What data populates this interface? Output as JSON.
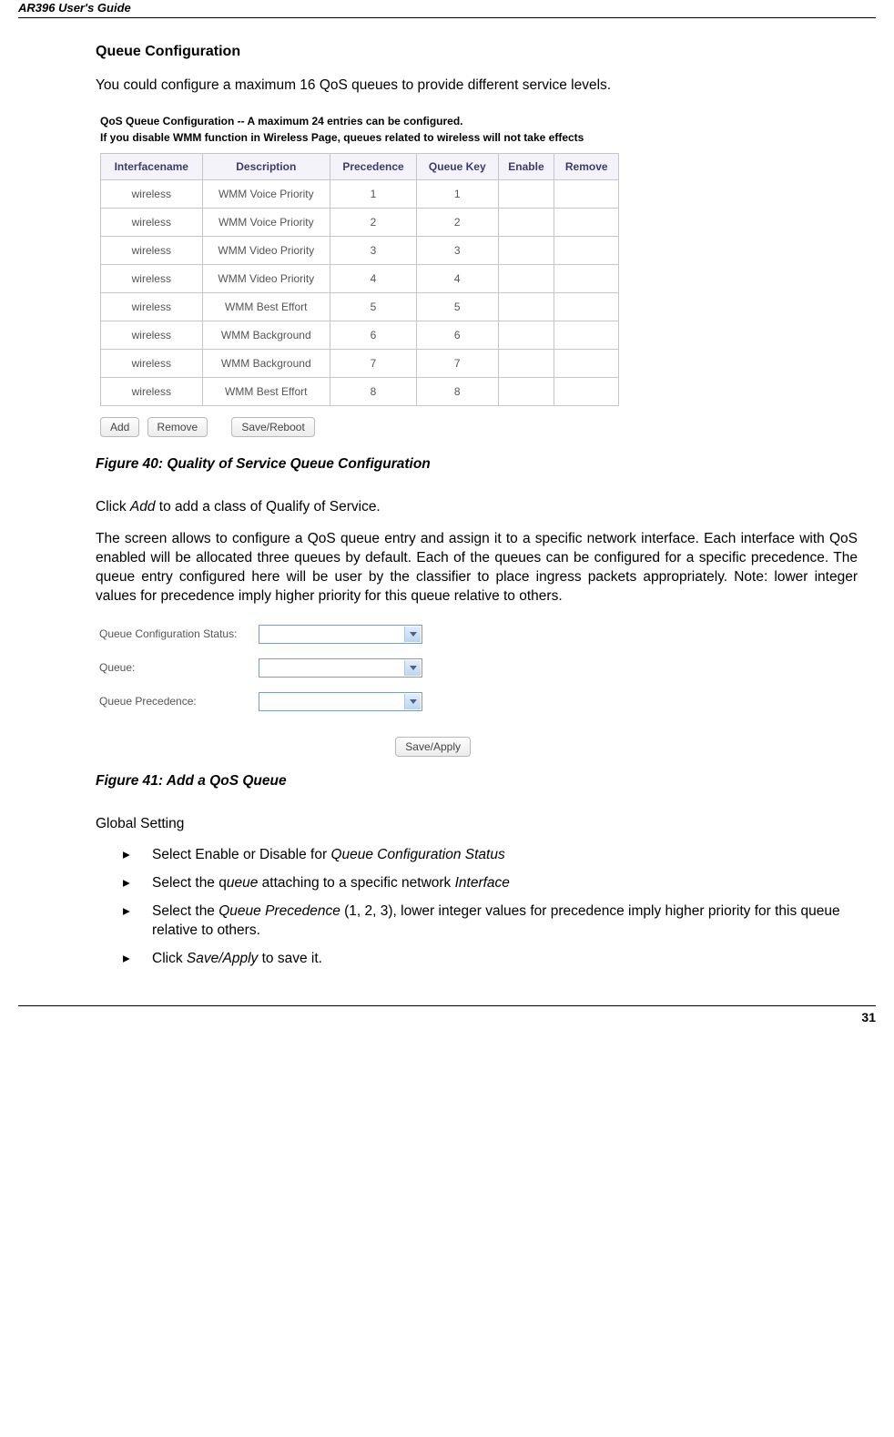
{
  "header": {
    "guide_title": "AR396 User's Guide"
  },
  "section": {
    "queue_cfg_title": "Queue Configuration",
    "intro": "You could configure a maximum 16 QoS queues to provide different service levels."
  },
  "fig1": {
    "heading_l1": "QoS Queue Configuration -- A maximum 24 entries can be configured.",
    "heading_l2": "If you disable WMM function in Wireless Page, queues related to wireless will not take effects",
    "cols": [
      "Interfacename",
      "Description",
      "Precedence",
      "Queue Key",
      "Enable",
      "Remove"
    ],
    "rows": [
      {
        "iface": "wireless",
        "desc": "WMM Voice Priority",
        "prec": "1",
        "qk": "1"
      },
      {
        "iface": "wireless",
        "desc": "WMM Voice Priority",
        "prec": "2",
        "qk": "2"
      },
      {
        "iface": "wireless",
        "desc": "WMM Video Priority",
        "prec": "3",
        "qk": "3"
      },
      {
        "iface": "wireless",
        "desc": "WMM Video Priority",
        "prec": "4",
        "qk": "4"
      },
      {
        "iface": "wireless",
        "desc": "WMM Best Effort",
        "prec": "5",
        "qk": "5"
      },
      {
        "iface": "wireless",
        "desc": "WMM Background",
        "prec": "6",
        "qk": "6"
      },
      {
        "iface": "wireless",
        "desc": "WMM Background",
        "prec": "7",
        "qk": "7"
      },
      {
        "iface": "wireless",
        "desc": "WMM Best Effort",
        "prec": "8",
        "qk": "8"
      }
    ],
    "btn_add": "Add",
    "btn_remove": "Remove",
    "btn_save": "Save/Reboot",
    "caption": "Figure 40: Quality of Service Queue Configuration"
  },
  "body2": {
    "click_add": "Click Add to add a class of Qualify of Service.",
    "desc": "The screen allows to configure a QoS queue entry and assign it to a specific network interface. Each interface with QoS enabled will be allocated three queues by default. Each of the queues can be configured for a specific precedence. The queue entry configured here will be user by the classifier to place ingress packets appropriately. Note: lower integer values for precedence imply higher priority for this queue relative to others."
  },
  "fig2": {
    "label_status": "Queue Configuration Status:",
    "label_queue": "Queue:",
    "label_prec": "Queue Precedence:",
    "btn_save": "Save/Apply",
    "caption": "Figure 41: Add a QoS Queue"
  },
  "global": {
    "heading": "Global Setting",
    "b1": "Select Enable or Disable for Queue Configuration Status",
    "b2": "Select the queue attaching to a specific network Interface",
    "b3": "Select the Queue Precedence (1, 2, 3), lower integer values for precedence imply higher priority for this queue relative to others.",
    "b4": "Click Save/Apply to save it."
  },
  "page_number": "31"
}
